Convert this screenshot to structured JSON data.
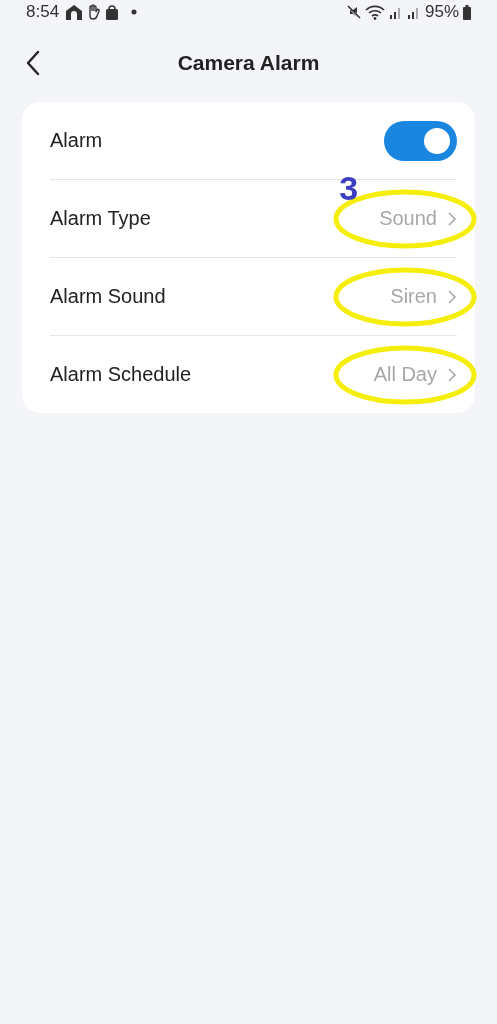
{
  "status_bar": {
    "time": "8:54",
    "battery": "95%"
  },
  "header": {
    "title": "Camera Alarm"
  },
  "rows": [
    {
      "kind": "toggle",
      "label": "Alarm",
      "on": true
    },
    {
      "kind": "link",
      "label": "Alarm Type",
      "value": "Sound",
      "highlighted": true,
      "annotation": "3"
    },
    {
      "kind": "link",
      "label": "Alarm Sound",
      "value": "Siren",
      "highlighted": true
    },
    {
      "kind": "link",
      "label": "Alarm Schedule",
      "value": "All Day",
      "highlighted": true
    }
  ]
}
